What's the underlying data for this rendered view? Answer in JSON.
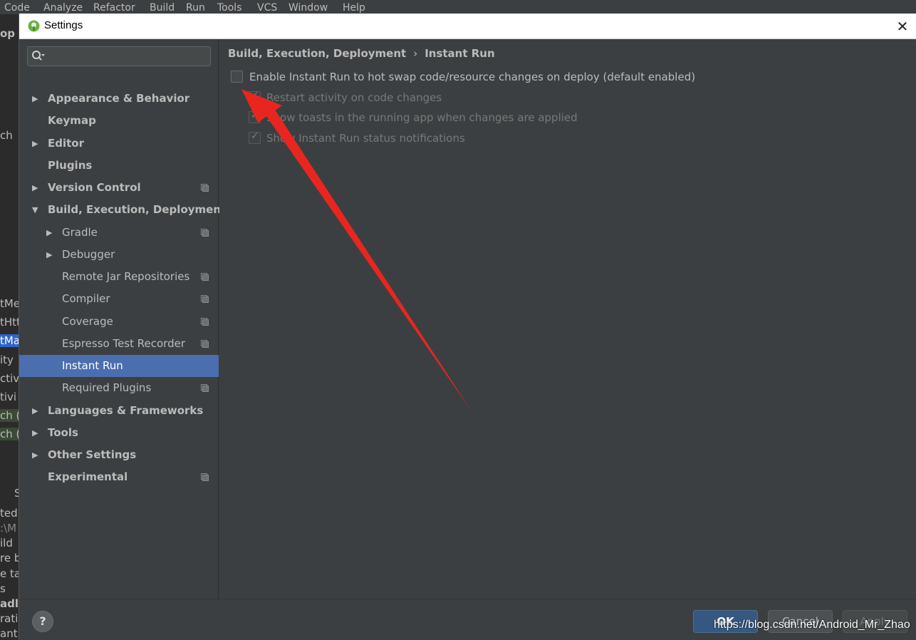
{
  "ide_menubar": {
    "items": [
      "Code",
      "Analyze",
      "Refactor",
      "Build",
      "Run",
      "Tools",
      "VCS",
      "Window",
      "Help"
    ]
  },
  "ide_left_fragments": [
    "op",
    "ch",
    "tMe",
    "tHtt",
    "tMa",
    "ity",
    "ctivi",
    "tivi",
    "ch (",
    "ch (",
    "S",
    "ted s",
    ":\\M",
    "ild",
    "re b",
    "e tas",
    "s",
    "adle",
    "ratio",
    "ant."
  ],
  "dialog": {
    "title": "Settings",
    "close_glyph": "✕"
  },
  "search": {
    "placeholder": ""
  },
  "tree": [
    {
      "label": "Appearance & Behavior",
      "bold": true,
      "arrow": "▶",
      "level": 0,
      "proj": false,
      "selected": false
    },
    {
      "label": "Keymap",
      "bold": true,
      "arrow": "",
      "level": 0,
      "proj": false,
      "selected": false
    },
    {
      "label": "Editor",
      "bold": true,
      "arrow": "▶",
      "level": 0,
      "proj": false,
      "selected": false
    },
    {
      "label": "Plugins",
      "bold": true,
      "arrow": "",
      "level": 0,
      "proj": false,
      "selected": false
    },
    {
      "label": "Version Control",
      "bold": true,
      "arrow": "▶",
      "level": 0,
      "proj": true,
      "selected": false
    },
    {
      "label": "Build, Execution, Deployment",
      "bold": true,
      "arrow": "▼",
      "level": 0,
      "proj": false,
      "selected": false
    },
    {
      "label": "Gradle",
      "bold": false,
      "arrow": "▶",
      "level": 1,
      "proj": true,
      "selected": false
    },
    {
      "label": "Debugger",
      "bold": false,
      "arrow": "▶",
      "level": 1,
      "proj": false,
      "selected": false
    },
    {
      "label": "Remote Jar Repositories",
      "bold": false,
      "arrow": "",
      "level": 1,
      "proj": true,
      "selected": false
    },
    {
      "label": "Compiler",
      "bold": false,
      "arrow": "",
      "level": 1,
      "proj": true,
      "selected": false
    },
    {
      "label": "Coverage",
      "bold": false,
      "arrow": "",
      "level": 1,
      "proj": true,
      "selected": false
    },
    {
      "label": "Espresso Test Recorder",
      "bold": false,
      "arrow": "",
      "level": 1,
      "proj": true,
      "selected": false
    },
    {
      "label": "Instant Run",
      "bold": false,
      "arrow": "",
      "level": 1,
      "proj": false,
      "selected": true
    },
    {
      "label": "Required Plugins",
      "bold": false,
      "arrow": "",
      "level": 1,
      "proj": true,
      "selected": false
    },
    {
      "label": "Languages & Frameworks",
      "bold": true,
      "arrow": "▶",
      "level": 0,
      "proj": false,
      "selected": false
    },
    {
      "label": "Tools",
      "bold": true,
      "arrow": "▶",
      "level": 0,
      "proj": false,
      "selected": false
    },
    {
      "label": "Other Settings",
      "bold": true,
      "arrow": "▶",
      "level": 0,
      "proj": false,
      "selected": false
    },
    {
      "label": "Experimental",
      "bold": true,
      "arrow": "",
      "level": 0,
      "proj": true,
      "selected": false
    }
  ],
  "breadcrumb": {
    "parent": "Build, Execution, Deployment",
    "separator": "›",
    "current": "Instant Run"
  },
  "options": {
    "enable_instant_run": {
      "label": "Enable Instant Run to hot swap code/resource changes on deploy (default enabled)",
      "checked": false,
      "enabled": true
    },
    "restart_activity": {
      "label": "Restart activity on code changes",
      "checked": true,
      "enabled": false
    },
    "show_toasts": {
      "label": "Show toasts in the running app when changes are applied",
      "checked": true,
      "enabled": false
    },
    "show_status": {
      "label": "Show Instant Run status notifications",
      "checked": true,
      "enabled": false
    }
  },
  "footer": {
    "help_label": "?",
    "ok_label": "OK",
    "cancel_label": "Cancel",
    "apply_label": "Apply"
  },
  "watermark": "https://blog.csdn.net/Android_Mr_Zhao",
  "colors": {
    "accent_selected": "#4b6eaf",
    "annotation_arrow": "#e8261f",
    "ok_button": "#365880"
  }
}
